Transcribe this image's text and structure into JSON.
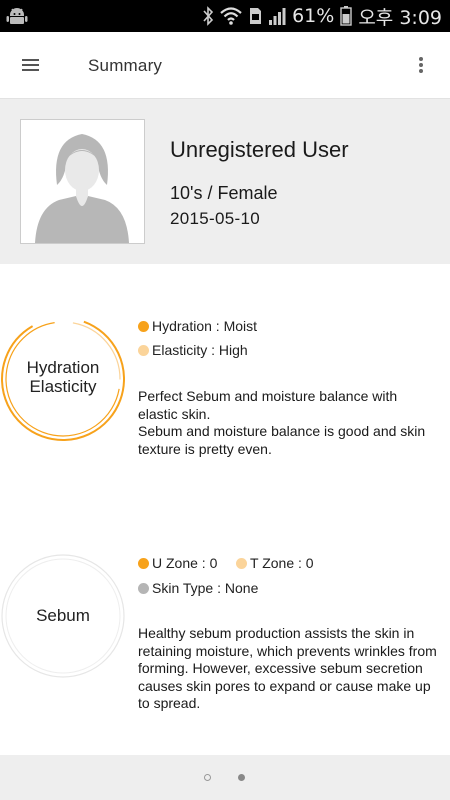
{
  "status_bar": {
    "battery_percent": "61%",
    "time": "오후 3:09",
    "icons": [
      "android-icon",
      "bluetooth-icon",
      "wifi-icon",
      "sd-card-icon",
      "signal-icon",
      "battery-icon"
    ]
  },
  "app_bar": {
    "title": "Summary",
    "menu_icon": "hamburger-menu-icon",
    "more_icon": "more-vert-icon"
  },
  "profile": {
    "name": "Unregistered User",
    "age_gender": "10's / Female",
    "date": "2015-05-10",
    "avatar_icon": "female-avatar-icon"
  },
  "hydration": {
    "ring_label_line1": "Hydration",
    "ring_label_line2": "Elasticity",
    "legend": [
      {
        "label": "Hydration :  Moist",
        "color": "#f7a21b"
      },
      {
        "label": "Elasticity :  High",
        "color": "#fbd49a"
      }
    ],
    "description": "Perfect Sebum and moisture balance with elastic skin.\nSebum and moisture balance is good and skin texture is pretty even.",
    "ring_color": "#f7a21b"
  },
  "sebum": {
    "ring_label": "Sebum",
    "legend_u": {
      "label": "U Zone : 0",
      "color": "#f7a21b"
    },
    "legend_t": {
      "label": "T Zone : 0",
      "color": "#fbd49a"
    },
    "legend_type": {
      "label": "Skin Type : None",
      "color": "#b5b5b5"
    },
    "description": "Healthy sebum production assists the skin in retaining moisture, which prevents wrinkles from forming. However, excessive sebum secretion causes skin pores to expand or cause make up to spread.",
    "ring_color": "#e6e6e6"
  },
  "pager": {
    "count": 2,
    "active_index": 1
  }
}
